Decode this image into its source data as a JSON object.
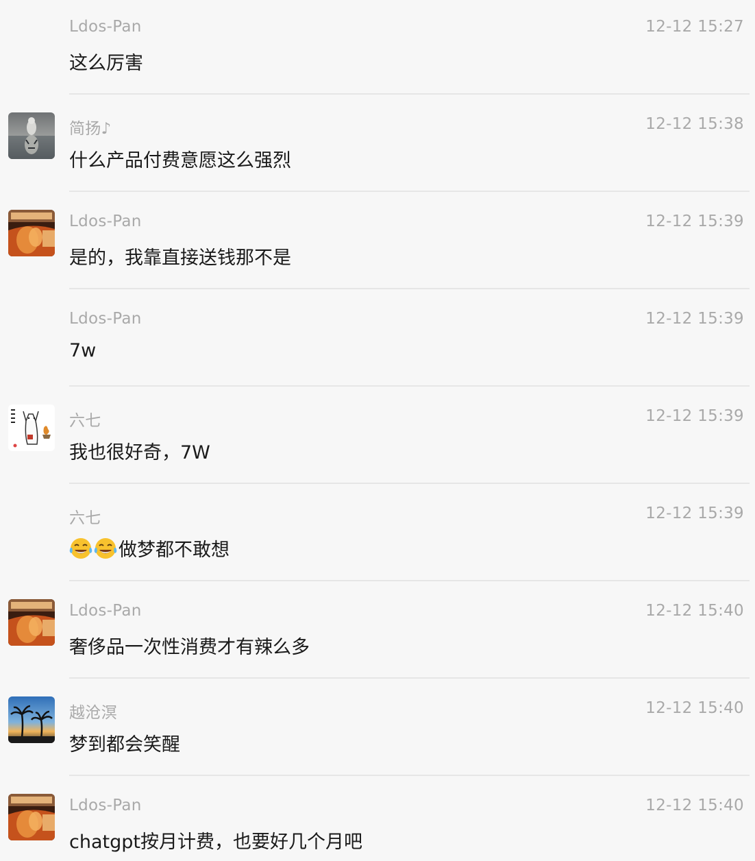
{
  "messages": [
    {
      "sender": "Ldos-Pan",
      "time": "12-12 15:27",
      "text": "这么厉害",
      "avatar": "none"
    },
    {
      "sender": "简扬♪",
      "time": "12-12 15:38",
      "text": "什么产品付费意愿这么强烈",
      "avatar": "cat-tiger-reflection-avatar"
    },
    {
      "sender": "Ldos-Pan",
      "time": "12-12 15:39",
      "text": "是的，我靠直接送钱那不是",
      "avatar": "girl-in-car-avatar"
    },
    {
      "sender": "Ldos-Pan",
      "time": "12-12 15:39",
      "text": "7w",
      "avatar": "none"
    },
    {
      "sender": "六七",
      "time": "12-12 15:39",
      "text": "我也很好奇，7W",
      "avatar": "sketch-dog-avatar"
    },
    {
      "sender": "六七",
      "time": "12-12 15:39",
      "text": "做梦都不敢想",
      "emoji": [
        "tears-of-joy-emoji",
        "tears-of-joy-emoji"
      ],
      "avatar": "none"
    },
    {
      "sender": "Ldos-Pan",
      "time": "12-12 15:40",
      "text": "奢侈品一次性消费才有辣么多",
      "avatar": "girl-in-car-avatar"
    },
    {
      "sender": "越沧溟",
      "time": "12-12 15:40",
      "text": "梦到都会笑醒",
      "avatar": "palm-tree-sunset-avatar"
    },
    {
      "sender": "Ldos-Pan",
      "time": "12-12 15:40",
      "text": "chatgpt按月计费，也要好几个月吧",
      "avatar": "girl-in-car-avatar"
    }
  ]
}
